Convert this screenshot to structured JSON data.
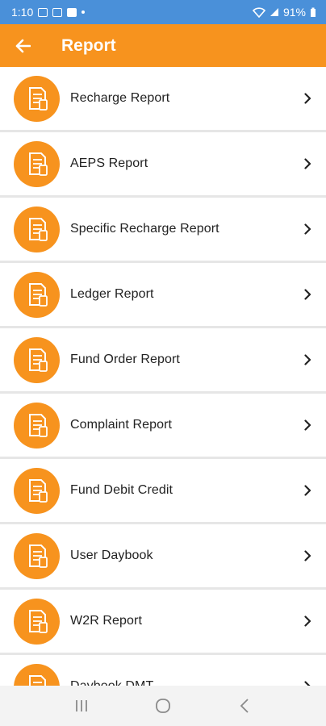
{
  "status_bar": {
    "time": "1:10",
    "battery": "91%",
    "icons": [
      "gallery-icon",
      "cast-icon",
      "youtube-icon",
      "notification-dot-icon",
      "wifi-icon",
      "signal-icon",
      "battery-icon"
    ]
  },
  "header": {
    "title": "Report",
    "back_icon": "arrow-left-icon"
  },
  "menu": {
    "items": [
      {
        "label": "Recharge Report",
        "icon": "mobile-receipt-icon"
      },
      {
        "label": "AEPS Report",
        "icon": "fingerprint-receipt-icon"
      },
      {
        "label": "Specific Recharge Report",
        "icon": "mobile-receipt-icon"
      },
      {
        "label": "Ledger Report",
        "icon": "ledger-icon"
      },
      {
        "label": "Fund Order Report",
        "icon": "fund-order-icon"
      },
      {
        "label": "Complaint Report",
        "icon": "complaint-icon"
      },
      {
        "label": "Fund Debit Credit",
        "icon": "debit-credit-icon"
      },
      {
        "label": "User Daybook",
        "icon": "daybook-icon"
      },
      {
        "label": "W2R Report",
        "icon": "w2r-icon"
      },
      {
        "label": "Daybook DMT",
        "icon": "daybook-dmt-icon"
      }
    ]
  },
  "nav_bar": {
    "icons": [
      "recent-apps-icon",
      "home-icon",
      "back-icon"
    ]
  },
  "colors": {
    "accent": "#f7931e",
    "status_bar": "#4a90d9",
    "text": "#222222",
    "background": "#e6e6e6"
  }
}
